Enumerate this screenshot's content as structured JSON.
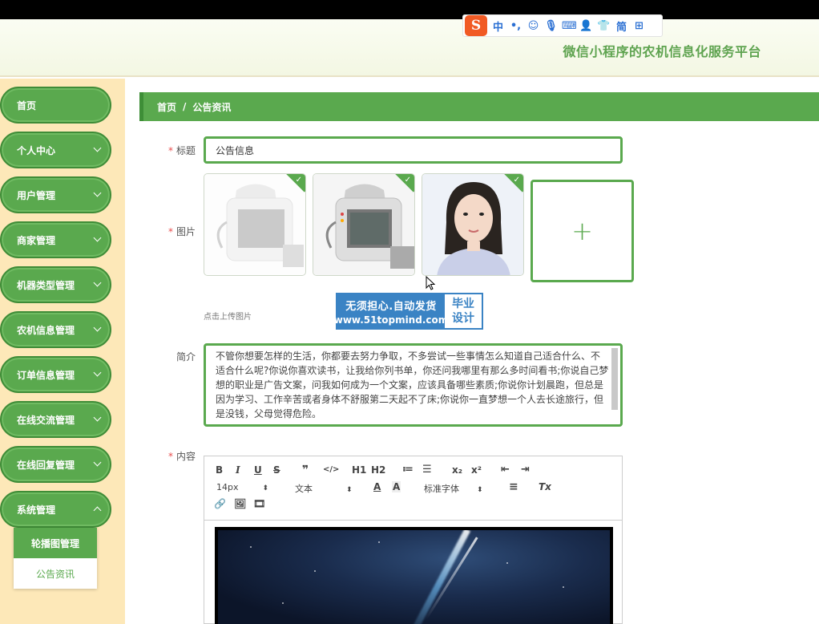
{
  "ime": {
    "logo": "S",
    "items": [
      "中",
      "•,",
      "☺",
      "🎙",
      "⌨",
      "👤",
      "👕",
      "简",
      "⊞"
    ]
  },
  "header": {
    "site_title": "微信小程序的农机信息化服务平台"
  },
  "sidebar": {
    "items": [
      {
        "label": "首页",
        "has_arrow": false
      },
      {
        "label": "个人中心",
        "has_arrow": true
      },
      {
        "label": "用户管理",
        "has_arrow": true
      },
      {
        "label": "商家管理",
        "has_arrow": true
      },
      {
        "label": "机器类型管理",
        "has_arrow": true
      },
      {
        "label": "农机信息管理",
        "has_arrow": true
      },
      {
        "label": "订单信息管理",
        "has_arrow": true
      },
      {
        "label": "在线交流管理",
        "has_arrow": true
      },
      {
        "label": "在线回复管理",
        "has_arrow": true
      },
      {
        "label": "系统管理",
        "has_arrow": true
      }
    ],
    "submenu": [
      {
        "label": "轮播图管理",
        "active": true
      },
      {
        "label": "公告资讯",
        "active": false
      }
    ]
  },
  "breadcrumb": {
    "home": "首页",
    "sep": "/",
    "current": "公告资讯"
  },
  "form": {
    "title_label": "标题",
    "title_value": "公告信息",
    "image_label": "图片",
    "upload_tip": "点击上传图片",
    "upload_plus": "+",
    "intro_label": "简介",
    "intro_text": "不管你想要怎样的生活，你都要去努力争取，不多尝试一些事情怎么知道自己适合什么、不适合什么呢?你说你喜欢读书，让我给你列书单，你还问我哪里有那么多时间看书;你说自己梦想的职业是广告文案，问我如何成为一个文案，应该具备哪些素质;你说你计划晨跑，但总是因为学习、工作辛苦或者身体不舒服第二天起不了床;你说你一直梦想一个人去长途旅行，但是没钱，父母觉得危险。",
    "content_label": "内容",
    "required_mark": "*"
  },
  "watermark": {
    "line1": "无须担心.自动发货",
    "line2": "www.51topmind.com",
    "right1": "毕业",
    "right2": "设计"
  },
  "editor": {
    "toolbar_row1": [
      "B",
      "I",
      "U",
      "S",
      "❞",
      "</>",
      "H1",
      "H2",
      "≔",
      "☰",
      "x₂",
      "x²",
      "⇤",
      "⇥"
    ],
    "font_size": "14px",
    "text_style": "文本",
    "font_family": "标准字体",
    "color_icon": "A",
    "bg_icon": "A",
    "align_icon": "≡",
    "clear_icon": "Tx",
    "toolbar_row3": [
      "🔗",
      "🖼",
      "🎞"
    ]
  }
}
